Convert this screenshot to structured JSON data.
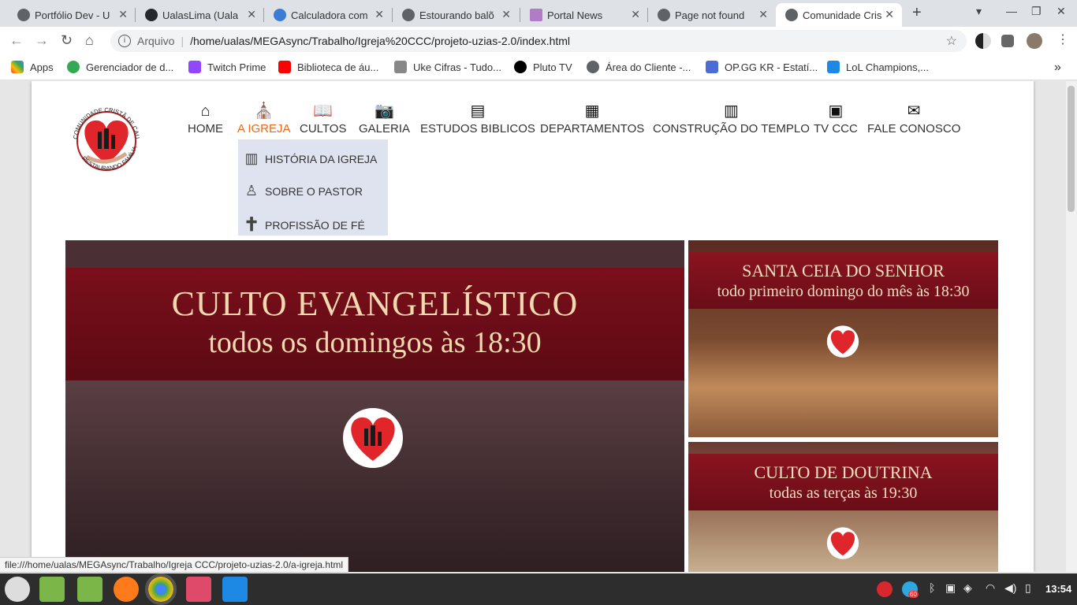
{
  "browser": {
    "tabs": [
      {
        "title": "Portfólio Dev - U",
        "color": "#5f6368"
      },
      {
        "title": "UalasLima (Uala",
        "color": "#24292e"
      },
      {
        "title": "Calculadora com",
        "color": "#3a7bd5"
      },
      {
        "title": "Estourando balõ",
        "color": "#5f6368"
      },
      {
        "title": "Portal News",
        "color": "#b07cc6"
      },
      {
        "title": "Page not found",
        "color": "#5f6368"
      },
      {
        "title": "Comunidade Cris",
        "color": "#5f6368"
      }
    ],
    "address_label": "Arquivo",
    "url": "/home/ualas/MEGAsync/Trabalho/Igreja%20CCC/projeto-uzias-2.0/index.html",
    "bookmarks": [
      {
        "label": "Apps",
        "color": "#4285f4"
      },
      {
        "label": "Gerenciador de d...",
        "color": "#34a853"
      },
      {
        "label": "Twitch Prime",
        "color": "#9146ff"
      },
      {
        "label": "Biblioteca de áu...",
        "color": "#ff0000"
      },
      {
        "label": "Uke Cifras - Tudo...",
        "color": "#888888"
      },
      {
        "label": "Pluto TV",
        "color": "#000000"
      },
      {
        "label": "Área do Cliente -...",
        "color": "#5f6368"
      },
      {
        "label": "OP.GG KR - Estatí...",
        "color": "#4a6cd4"
      },
      {
        "label": "LoL Champions,...",
        "color": "#1e88e5"
      }
    ]
  },
  "site": {
    "logo_text_top": "COMUNIDADE CRISTÃ DE CAUCAIA",
    "logo_text_bottom": "RESTAURANDO FAMÍLIAS",
    "menu": [
      {
        "label": "HOME",
        "icon": "home-icon"
      },
      {
        "label": "A IGREJA",
        "icon": "church-icon"
      },
      {
        "label": "CULTOS",
        "icon": "bible-icon"
      },
      {
        "label": "GALERIA",
        "icon": "camera-icon"
      },
      {
        "label": "ESTUDOS BIBLICOS",
        "icon": "book-icon"
      },
      {
        "label": "DEPARTAMENTOS",
        "icon": "cabinet-icon"
      },
      {
        "label": "CONSTRUÇÃO DO TEMPLO",
        "icon": "bricks-icon"
      },
      {
        "label": "TV CCC",
        "icon": "tv-icon"
      },
      {
        "label": "FALE CONOSCO",
        "icon": "mail-icon"
      }
    ],
    "active_color": "#e86a17",
    "dropdown": [
      {
        "label": "HISTÓRIA DA IGREJA",
        "icon": "books-icon"
      },
      {
        "label": "SOBRE O PASTOR",
        "icon": "person-icon"
      },
      {
        "label": "PROFISSÃO DE FÉ",
        "icon": "cross-icon"
      }
    ],
    "banner_main": {
      "line1": "CULTO EVANGELÍSTICO",
      "line2": "todos os domingos às 18:30"
    },
    "banner_side1": {
      "line1": "SANTA CEIA DO SENHOR",
      "line2": "todo primeiro domingo do mês às 18:30"
    },
    "banner_side2": {
      "line1": "CULTO DE DOUTRINA",
      "line2": "todas as terças às 19:30"
    }
  },
  "status_url": "file:///home/ualas/MEGAsync/Trabalho/Igreja CCC/projeto-uzias-2.0/a-igreja.html",
  "taskbar": {
    "clock": "13:54",
    "badge": "60"
  }
}
